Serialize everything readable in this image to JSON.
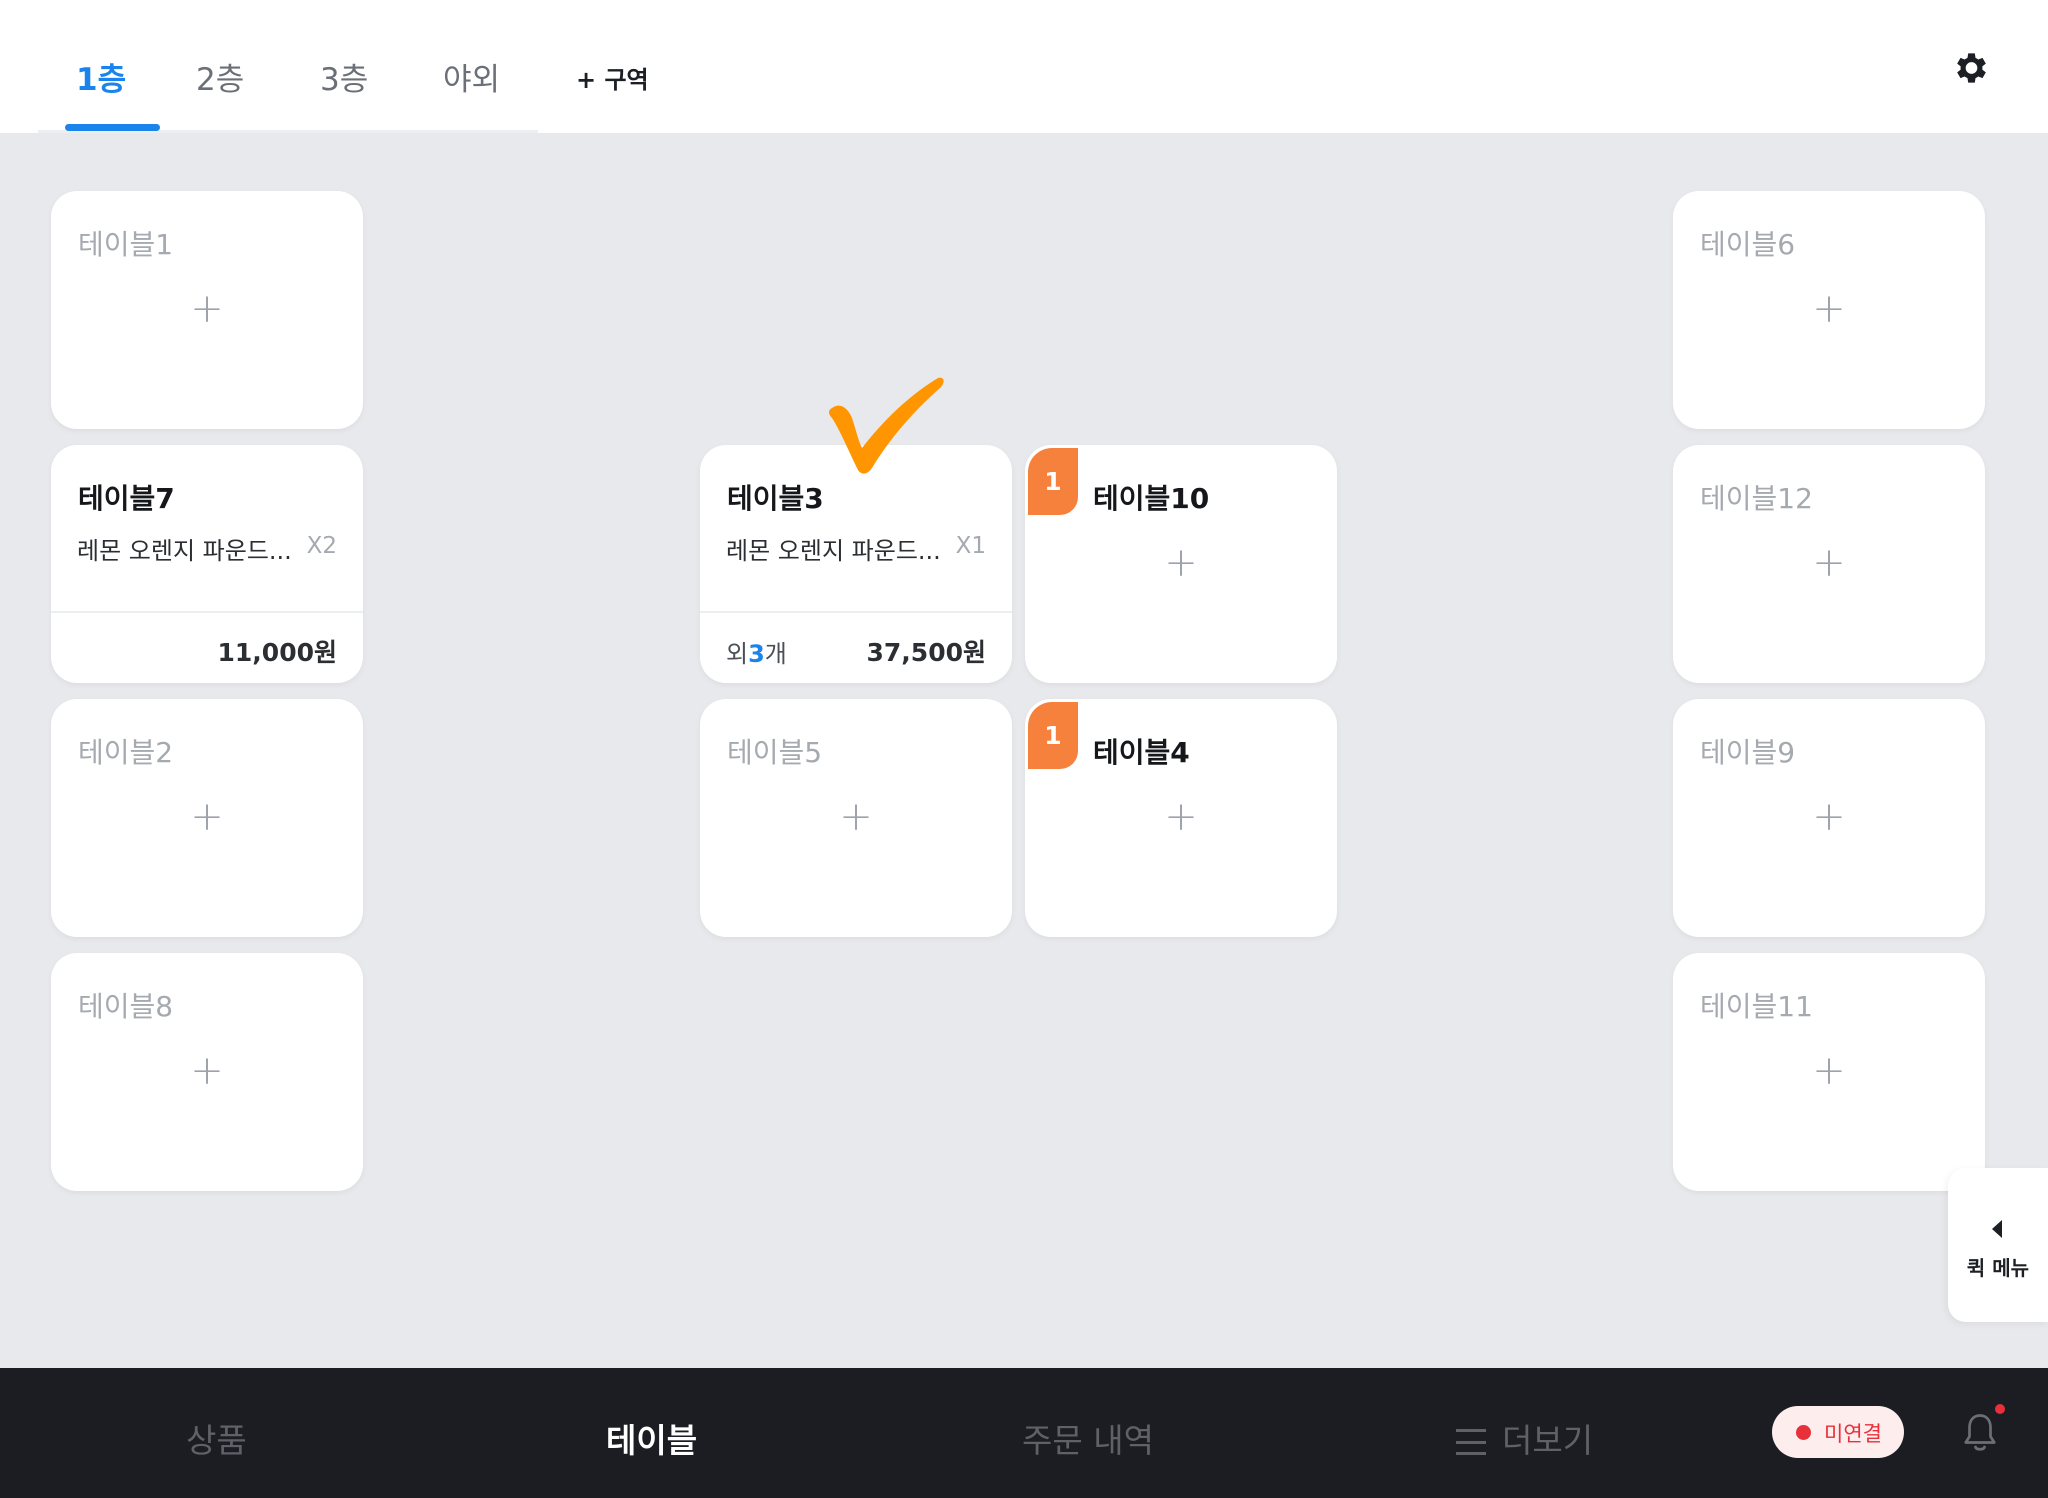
{
  "tabs": [
    {
      "label": "1층",
      "active": true
    },
    {
      "label": "2층",
      "active": false
    },
    {
      "label": "3층",
      "active": false
    },
    {
      "label": "야외",
      "active": false
    }
  ],
  "add_zone_label": "+ 구역",
  "icons": {
    "settings": "gear-icon",
    "check": "check-mark-icon",
    "notifications": "bell-icon",
    "quick_arrow": "caret-left-icon",
    "menu": "hamburger-icon"
  },
  "colors": {
    "accent": "#1a84ec",
    "badge": "#f5813c",
    "check": "#ff9500",
    "nav_bg": "#1c1d22",
    "disconnected": "#e8303a"
  },
  "tables": {
    "t1": {
      "name": "테이블1",
      "plus": "+"
    },
    "t6": {
      "name": "테이블6",
      "plus": "+"
    },
    "t7": {
      "name": "테이블7",
      "item": "레몬 오렌지 파운드...",
      "qty": "X2",
      "total": "11,000원"
    },
    "t3": {
      "name": "테이블3",
      "item": "레몬 오렌지 파운드...",
      "qty": "X1",
      "more_prefix": "외",
      "more_count": "3",
      "more_suffix": "개",
      "total": "37,500원"
    },
    "t10": {
      "name": "테이블10",
      "badge": "1",
      "plus": "+"
    },
    "t12": {
      "name": "테이블12",
      "plus": "+"
    },
    "t2": {
      "name": "테이블2",
      "plus": "+"
    },
    "t5": {
      "name": "테이블5",
      "plus": "+"
    },
    "t4": {
      "name": "테이블4",
      "badge": "1",
      "plus": "+"
    },
    "t9": {
      "name": "테이블9",
      "plus": "+"
    },
    "t8": {
      "name": "테이블8",
      "plus": "+"
    },
    "t11": {
      "name": "테이블11",
      "plus": "+"
    }
  },
  "quick_menu_label": "퀵 메뉴",
  "bottom_nav": {
    "products": "상품",
    "tables": "테이블",
    "orders": "주문 내역",
    "more": "더보기",
    "status": "미연결"
  }
}
